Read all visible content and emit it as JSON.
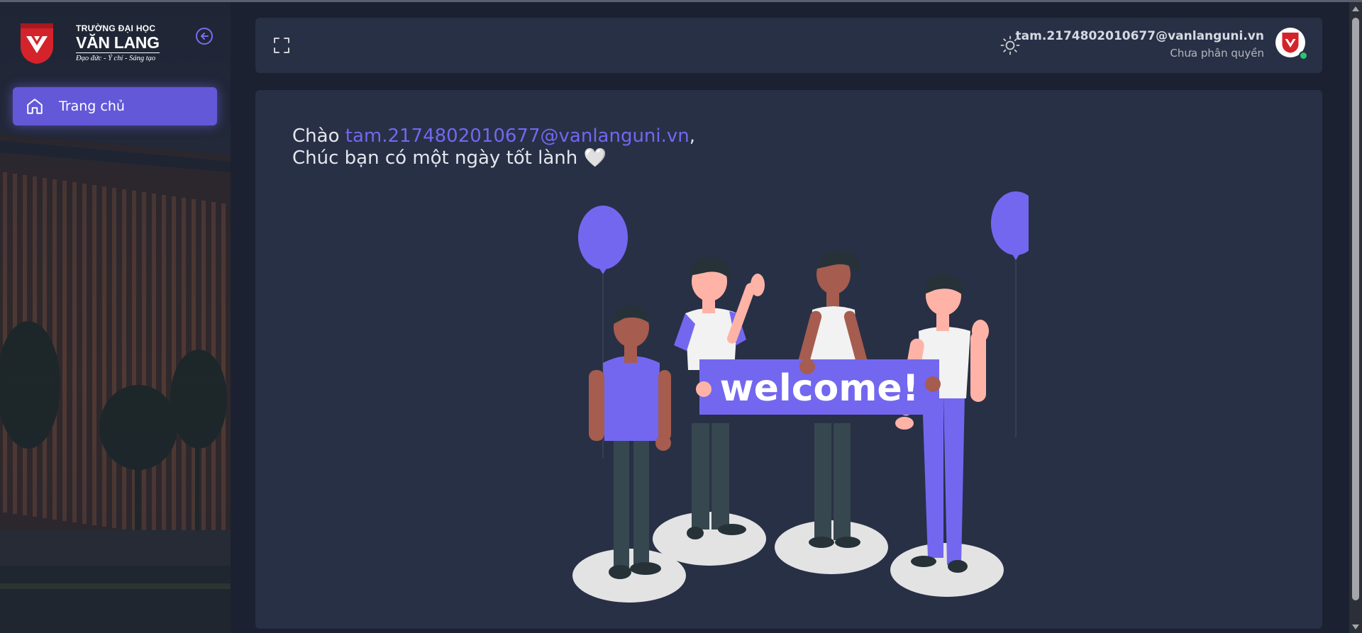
{
  "brand": {
    "line1": "TRƯỜNG ĐẠI HỌC",
    "line2": "VĂN LANG",
    "tagline": "Đạo đức - Ý chí - Sáng tạo"
  },
  "sidebar": {
    "items": [
      {
        "label": "Trang chủ",
        "icon": "home-icon",
        "active": true
      }
    ]
  },
  "header": {
    "user_email": "tam.2174802010677@vanlanguni.vn",
    "user_role": "Chưa phân quyền",
    "status": "online"
  },
  "main": {
    "greeting_prefix": "Chào ",
    "greeting_email": "tam.2174802010677@vanlanguni.vn",
    "greeting_suffix": ",",
    "greeting_line2": "Chúc bạn có một ngày tốt lành 🤍",
    "banner_text": "welcome!"
  },
  "colors": {
    "accent": "#7367f0",
    "card": "#283046",
    "background": "#1b2131",
    "brand_red": "#d4232b",
    "online": "#28c76f"
  }
}
